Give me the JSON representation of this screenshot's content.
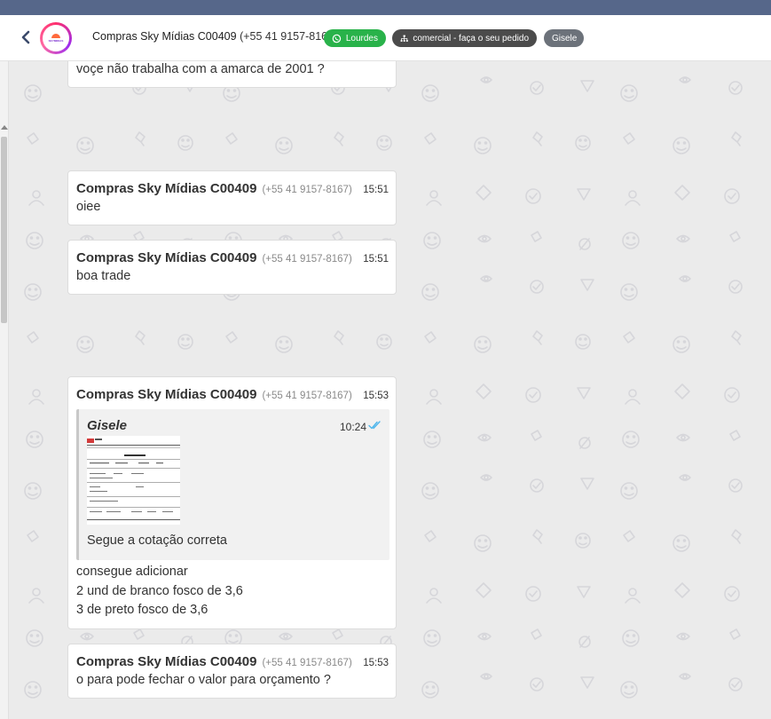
{
  "header": {
    "contact_name": "Compras Sky Mídias C00409",
    "contact_phone": "(+55 41 9157-8167)",
    "tags": {
      "channel": "Lourdes",
      "queue": "comercial - faça o seu pedido",
      "agent": "Gisele"
    },
    "avatar_text": "SKYMIDIAS"
  },
  "messages": {
    "m0": {
      "text": "voçe não trabalha com a amarca de 2001 ?"
    },
    "m1": {
      "sender": "Compras Sky Mídias C00409",
      "phone": "(+55 41 9157-8167)",
      "time": "15:51",
      "text": "oiee"
    },
    "m2": {
      "sender": "Compras Sky Mídias C00409",
      "phone": "(+55 41 9157-8167)",
      "time": "15:51",
      "text": "boa trade"
    },
    "m3": {
      "sender": "Compras Sky Mídias C00409",
      "phone": "(+55 41 9157-8167)",
      "time": "15:53",
      "quote": {
        "sender": "Gisele",
        "time": "10:24",
        "caption": "Segue a cotação correta"
      },
      "lines": [
        "consegue adicionar",
        "2 und de branco fosco de 3,6",
        "3 de preto fosco de 3,6"
      ]
    },
    "m4": {
      "sender": "Compras Sky Mídias C00409",
      "phone": "(+55 41 9157-8167)",
      "time": "15:53",
      "text": "o para pode fechar o valor para orçamento ?"
    }
  },
  "colors": {
    "topstrip": "#56678a",
    "tag_green": "#29b24a",
    "tag_dark": "#4b4b4b",
    "tag_gray": "#6c727a",
    "read_check": "#4fb6ec"
  }
}
